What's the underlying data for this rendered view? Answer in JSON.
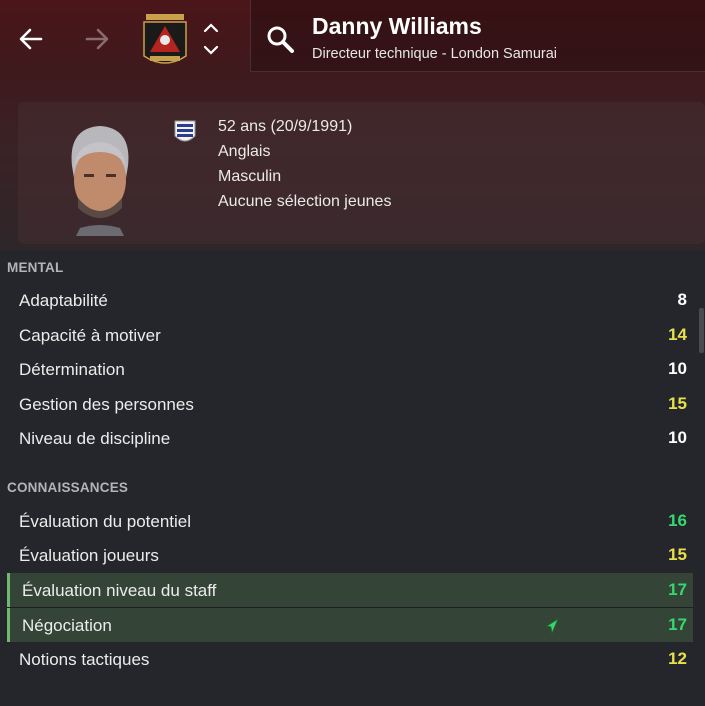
{
  "header": {
    "name": "Danny Williams",
    "role": "Directeur technique - London Samurai"
  },
  "info": {
    "age": "52 ans (20/9/1991)",
    "nationality": "Anglais",
    "gender": "Masculin",
    "youth_caps": "Aucune sélection jeunes"
  },
  "colors": {
    "accent_green": "#35d86f",
    "accent_yellow": "#e8e04a",
    "white_value": "#ffffff",
    "highlight_row": "#344538"
  },
  "sections": {
    "mental": {
      "title": "MENTAL",
      "rows": [
        {
          "label": "Adaptabilité",
          "value": "8"
        },
        {
          "label": "Capacité à motiver",
          "value": "14"
        },
        {
          "label": "Détermination",
          "value": "10"
        },
        {
          "label": "Gestion des personnes",
          "value": "15"
        },
        {
          "label": "Niveau de discipline",
          "value": "10"
        }
      ]
    },
    "knowledge": {
      "title": "CONNAISSANCES",
      "rows": [
        {
          "label": "Évaluation du potentiel",
          "value": "16"
        },
        {
          "label": "Évaluation joueurs",
          "value": "15"
        },
        {
          "label": "Évaluation niveau du staff",
          "value": "17"
        },
        {
          "label": "Négociation",
          "value": "17"
        },
        {
          "label": "Notions tactiques",
          "value": "12"
        }
      ]
    }
  }
}
